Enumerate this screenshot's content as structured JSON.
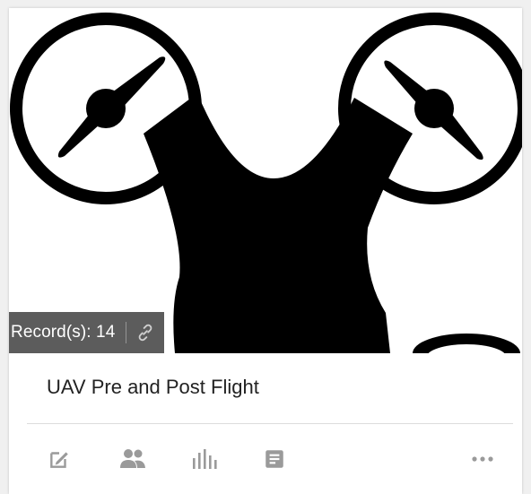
{
  "card": {
    "record_count_label": "Record(s): 14",
    "title": "UAV Pre and Post Flight"
  },
  "icons": {
    "thumbnail": "drone-icon",
    "link": "link-icon",
    "edit": "edit-icon",
    "share": "people-icon",
    "stats": "bar-chart-icon",
    "details": "document-icon",
    "more": "more-icon"
  },
  "colors": {
    "icon": "#9a9a9a",
    "overlay": "#464646",
    "text": "#222222"
  }
}
